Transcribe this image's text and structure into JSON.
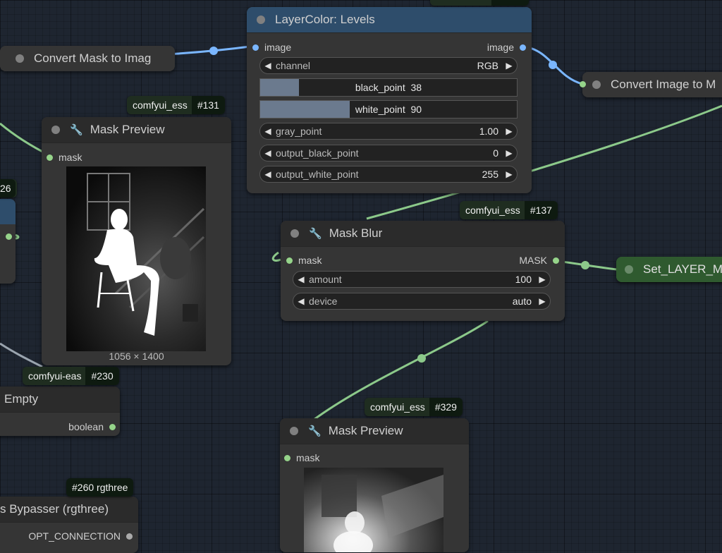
{
  "nodes": {
    "levels": {
      "title": "LayerColor: Levels",
      "input_label": "image",
      "output_label": "image",
      "channel": {
        "label": "channel",
        "value": "RGB"
      },
      "black_point": {
        "label": "black_point",
        "value": "38",
        "fraction": 0.15
      },
      "white_point": {
        "label": "white_point",
        "value": "90",
        "fraction": 0.35
      },
      "gray_point": {
        "label": "gray_point",
        "value": "1.00"
      },
      "output_black_point": {
        "label": "output_black_point",
        "value": "0"
      },
      "output_white_point": {
        "label": "output_white_point",
        "value": "255"
      }
    },
    "convert_mask": {
      "title": "Convert Mask to Imag"
    },
    "convert_image": {
      "title": "Convert Image to M"
    },
    "mask_preview_1": {
      "title": "Mask Preview",
      "input_label": "mask",
      "dimensions": "1056 × 1400"
    },
    "mask_blur": {
      "title": "Mask Blur",
      "input_label": "mask",
      "output_label": "MASK",
      "amount": {
        "label": "amount",
        "value": "100"
      },
      "device": {
        "label": "device",
        "value": "auto"
      }
    },
    "set_layer": {
      "title": "Set_LAYER_M"
    },
    "empty": {
      "title": "Empty",
      "output_label": "boolean"
    },
    "bypasser": {
      "title": "s Bypasser (rgthree)",
      "output_label": "OPT_CONNECTION"
    },
    "mask_preview_2": {
      "title": "Mask Preview",
      "input_label": "mask"
    },
    "left_stub": {
      "title": "26"
    }
  },
  "badges": {
    "b131": {
      "name": "comfyui_ess",
      "id": "#131"
    },
    "b137": {
      "name": "comfyui_ess",
      "id": "#137"
    },
    "b230": {
      "name": "comfyui-eas",
      "id": "#230"
    },
    "b329": {
      "name": "comfyui_ess",
      "id": "#329"
    },
    "b260": {
      "name": "",
      "id": "#260 rgthree"
    }
  },
  "colors": {
    "canvas": "#1e2530",
    "node": "#353535",
    "levels_title": "#2e4d6b",
    "set_node": "#2f5a2f",
    "mask_wire": "#96d48a",
    "image_wire": "#7ab6ff"
  }
}
